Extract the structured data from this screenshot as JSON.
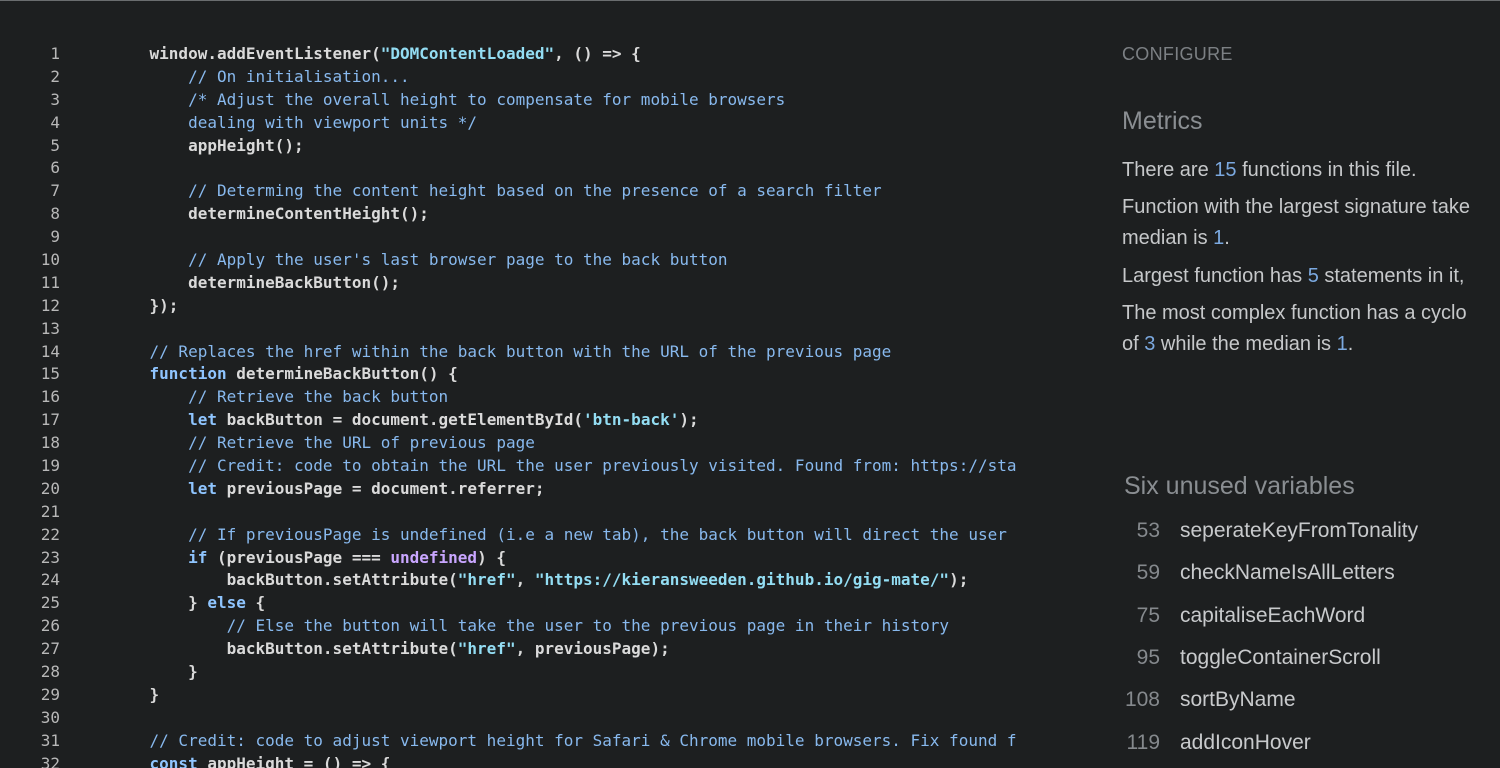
{
  "code_lines": [
    {
      "n": "1",
      "parts": [
        {
          "t": "    window.addEventListener(",
          "c": ""
        },
        {
          "t": "\"DOMContentLoaded\"",
          "c": "str"
        },
        {
          "t": ", () => {",
          "c": ""
        }
      ]
    },
    {
      "n": "2",
      "parts": [
        {
          "t": "        // On initialisation...",
          "c": "cm"
        }
      ]
    },
    {
      "n": "3",
      "parts": [
        {
          "t": "        /* Adjust the overall height to compensate for mobile browsers",
          "c": "cm"
        }
      ]
    },
    {
      "n": "4",
      "parts": [
        {
          "t": "        dealing with viewport units */",
          "c": "cm"
        }
      ]
    },
    {
      "n": "5",
      "parts": [
        {
          "t": "        appHeight();",
          "c": ""
        }
      ]
    },
    {
      "n": "6",
      "parts": [
        {
          "t": "",
          "c": ""
        }
      ]
    },
    {
      "n": "7",
      "parts": [
        {
          "t": "        // Determing the content height based on the presence of a search filter",
          "c": "cm"
        }
      ]
    },
    {
      "n": "8",
      "parts": [
        {
          "t": "        determineContentHeight();",
          "c": ""
        }
      ]
    },
    {
      "n": "9",
      "parts": [
        {
          "t": "",
          "c": ""
        }
      ]
    },
    {
      "n": "10",
      "parts": [
        {
          "t": "        // Apply the user's last browser page to the back button",
          "c": "cm"
        }
      ]
    },
    {
      "n": "11",
      "parts": [
        {
          "t": "        determineBackButton();",
          "c": ""
        }
      ]
    },
    {
      "n": "12",
      "parts": [
        {
          "t": "    });",
          "c": ""
        }
      ]
    },
    {
      "n": "13",
      "parts": [
        {
          "t": "",
          "c": ""
        }
      ]
    },
    {
      "n": "14",
      "parts": [
        {
          "t": "    // Replaces the href within the back button with the URL of the previous page",
          "c": "cm"
        }
      ]
    },
    {
      "n": "15",
      "parts": [
        {
          "t": "    ",
          "c": ""
        },
        {
          "t": "function",
          "c": "kw"
        },
        {
          "t": " determineBackButton() {",
          "c": ""
        }
      ]
    },
    {
      "n": "16",
      "parts": [
        {
          "t": "        // Retrieve the back button",
          "c": "cm"
        }
      ]
    },
    {
      "n": "17",
      "parts": [
        {
          "t": "        ",
          "c": ""
        },
        {
          "t": "let",
          "c": "kw"
        },
        {
          "t": " backButton = document.getElementById(",
          "c": ""
        },
        {
          "t": "'btn-back'",
          "c": "str"
        },
        {
          "t": ");",
          "c": ""
        }
      ]
    },
    {
      "n": "18",
      "parts": [
        {
          "t": "        // Retrieve the URL of previous page",
          "c": "cm"
        }
      ]
    },
    {
      "n": "19",
      "parts": [
        {
          "t": "        // Credit: code to obtain the URL the user previously visited. Found from: https://sta",
          "c": "cm"
        }
      ]
    },
    {
      "n": "20",
      "parts": [
        {
          "t": "        ",
          "c": ""
        },
        {
          "t": "let",
          "c": "kw"
        },
        {
          "t": " previousPage = document.referrer;",
          "c": ""
        }
      ]
    },
    {
      "n": "21",
      "parts": [
        {
          "t": "",
          "c": ""
        }
      ]
    },
    {
      "n": "22",
      "parts": [
        {
          "t": "        // If previousPage is undefined (i.e a new tab), the back button will direct the user",
          "c": "cm"
        }
      ]
    },
    {
      "n": "23",
      "parts": [
        {
          "t": "        ",
          "c": ""
        },
        {
          "t": "if",
          "c": "kw"
        },
        {
          "t": " (previousPage === ",
          "c": ""
        },
        {
          "t": "undefined",
          "c": "undef"
        },
        {
          "t": ") {",
          "c": ""
        }
      ]
    },
    {
      "n": "24",
      "parts": [
        {
          "t": "            backButton.setAttribute(",
          "c": ""
        },
        {
          "t": "\"href\"",
          "c": "str"
        },
        {
          "t": ", ",
          "c": ""
        },
        {
          "t": "\"https://kieransweeden.github.io/gig-mate/\"",
          "c": "str"
        },
        {
          "t": ");",
          "c": ""
        }
      ]
    },
    {
      "n": "25",
      "parts": [
        {
          "t": "        } ",
          "c": ""
        },
        {
          "t": "else",
          "c": "kw"
        },
        {
          "t": " {",
          "c": ""
        }
      ]
    },
    {
      "n": "26",
      "parts": [
        {
          "t": "            // Else the button will take the user to the previous page in their history",
          "c": "cm"
        }
      ]
    },
    {
      "n": "27",
      "parts": [
        {
          "t": "            backButton.setAttribute(",
          "c": ""
        },
        {
          "t": "\"href\"",
          "c": "str"
        },
        {
          "t": ", previousPage);",
          "c": ""
        }
      ]
    },
    {
      "n": "28",
      "parts": [
        {
          "t": "        }",
          "c": ""
        }
      ]
    },
    {
      "n": "29",
      "parts": [
        {
          "t": "    }",
          "c": ""
        }
      ]
    },
    {
      "n": "30",
      "parts": [
        {
          "t": "",
          "c": ""
        }
      ]
    },
    {
      "n": "31",
      "parts": [
        {
          "t": "    // Credit: code to adjust viewport height for Safari & Chrome mobile browsers. Fix found f",
          "c": "cm"
        }
      ]
    },
    {
      "n": "32",
      "parts": [
        {
          "t": "    ",
          "c": ""
        },
        {
          "t": "const",
          "c": "kw"
        },
        {
          "t": " appHeight = () => {",
          "c": ""
        }
      ]
    }
  ],
  "panel": {
    "configure_label": "CONFIGURE",
    "metrics_title": "Metrics",
    "metrics": [
      [
        {
          "t": "There are ",
          "c": ""
        },
        {
          "t": "15",
          "c": "num"
        },
        {
          "t": " functions in this file.",
          "c": ""
        }
      ],
      [
        {
          "t": "Function with the largest signature take",
          "c": ""
        }
      ],
      [
        {
          "t": "median is ",
          "c": ""
        },
        {
          "t": "1",
          "c": "num"
        },
        {
          "t": ".",
          "c": ""
        }
      ],
      [
        {
          "t": "Largest function has ",
          "c": ""
        },
        {
          "t": "5",
          "c": "num"
        },
        {
          "t": " statements in it,",
          "c": ""
        }
      ],
      [
        {
          "t": "The most complex function has a cyclo",
          "c": ""
        }
      ],
      [
        {
          "t": "of ",
          "c": ""
        },
        {
          "t": "3",
          "c": "num"
        },
        {
          "t": " while the median is ",
          "c": ""
        },
        {
          "t": "1",
          "c": "num"
        },
        {
          "t": ".",
          "c": ""
        }
      ]
    ],
    "unused_title": "Six unused variables",
    "unused_vars": [
      {
        "line": "53",
        "name": "seperateKeyFromTonality"
      },
      {
        "line": "59",
        "name": "checkNameIsAllLetters"
      },
      {
        "line": "75",
        "name": "capitaliseEachWord"
      },
      {
        "line": "95",
        "name": "toggleContainerScroll"
      },
      {
        "line": "108",
        "name": "sortByName"
      },
      {
        "line": "119",
        "name": "addIconHover"
      }
    ]
  }
}
